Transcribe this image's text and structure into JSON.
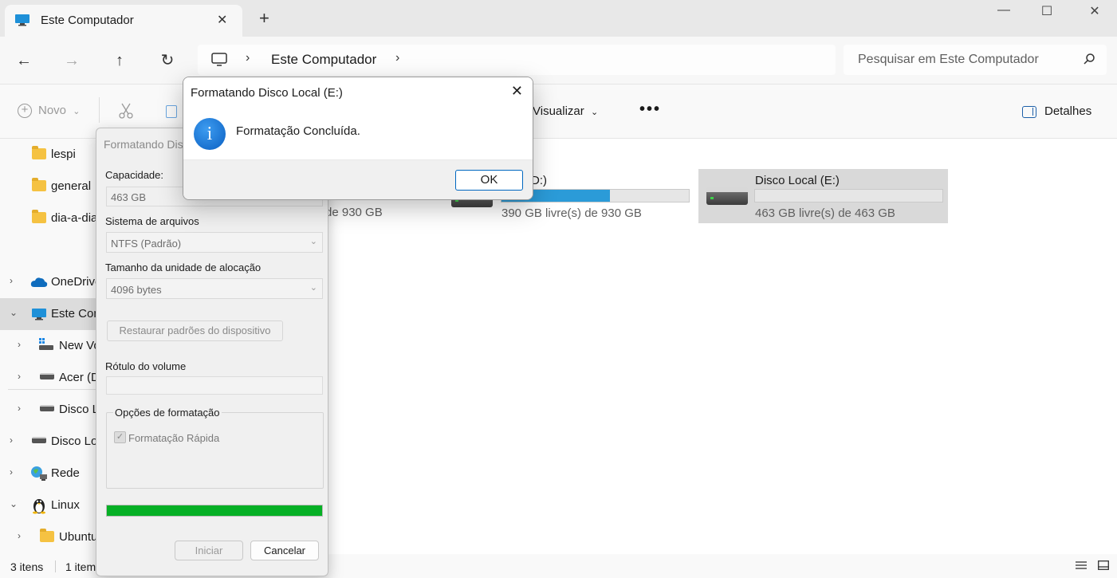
{
  "window": {
    "tab_title": "Este Computador",
    "tab_close": "✕",
    "tab_add": "+",
    "minimize": "—",
    "maximize": "☐",
    "close": "✕"
  },
  "nav": {
    "back": "←",
    "forward": "→",
    "up": "↑",
    "refresh": "↻"
  },
  "breadcrumb": {
    "sep1": "›",
    "location": "Este Computador",
    "sep2": "›"
  },
  "search": {
    "placeholder": "Pesquisar em Este Computador"
  },
  "toolbar": {
    "new_label": "Novo",
    "new_chevron": "⌄",
    "view_label": "Visualizar",
    "view_chevron": "⌄",
    "more": "•••",
    "details_label": "Detalhes"
  },
  "sidebar": {
    "folders": [
      {
        "label": "lespi"
      },
      {
        "label": "general"
      },
      {
        "label": "dia-a-dia"
      }
    ],
    "items": [
      {
        "label": "OneDrive",
        "chevron": "›"
      },
      {
        "label": "Este Computador",
        "chevron": "⌄"
      },
      {
        "label": "New Volume",
        "chevron": "›"
      },
      {
        "label": "Acer (D:)",
        "chevron": "›"
      },
      {
        "label": "Disco Local",
        "chevron": "›"
      },
      {
        "label": "Disco Local",
        "chevron": "›"
      },
      {
        "label": "Rede",
        "chevron": "›"
      },
      {
        "label": "Linux",
        "chevron": "⌄"
      },
      {
        "label": "Ubuntu",
        "chevron": "›"
      }
    ]
  },
  "drives": [
    {
      "name": "",
      "free": "de 930 GB",
      "used_fraction": 0.5
    },
    {
      "name": "D:)",
      "free": "390 GB livre(s) de 930 GB",
      "used_fraction": 0.58
    },
    {
      "name": "Disco Local (E:)",
      "free": "463 GB livre(s) de 463 GB",
      "used_fraction": 0.0
    }
  ],
  "status": {
    "count": "3 itens",
    "selected": "1 item"
  },
  "format_dialog": {
    "title": "Formatando Disco Local (E:)",
    "capacity_label": "Capacidade:",
    "capacity_value": "463 GB",
    "fs_label": "Sistema de arquivos",
    "fs_value": "NTFS (Padrão)",
    "alloc_label": "Tamanho da unidade de alocação",
    "alloc_value": "4096 bytes",
    "restore_button": "Restaurar padrões do dispositivo",
    "volume_label": "Rótulo do volume",
    "volume_value": "",
    "options_label": "Opções de formatação",
    "quick_format_label": "Formatação Rápida",
    "quick_format_checked": true,
    "progress": 1.0,
    "start_button": "Iniciar",
    "cancel_button": "Cancelar",
    "dropdown_glyph": "⌄"
  },
  "message_box": {
    "title": "Formatando Disco Local (E:)",
    "close": "✕",
    "icon_glyph": "i",
    "text": "Formatação Concluída.",
    "ok_button": "OK"
  },
  "colors": {
    "accent": "#0067c0",
    "drive_fill": "#2b9bd8",
    "progress_green": "#06b025",
    "info_blue": "#0a5fc2"
  }
}
